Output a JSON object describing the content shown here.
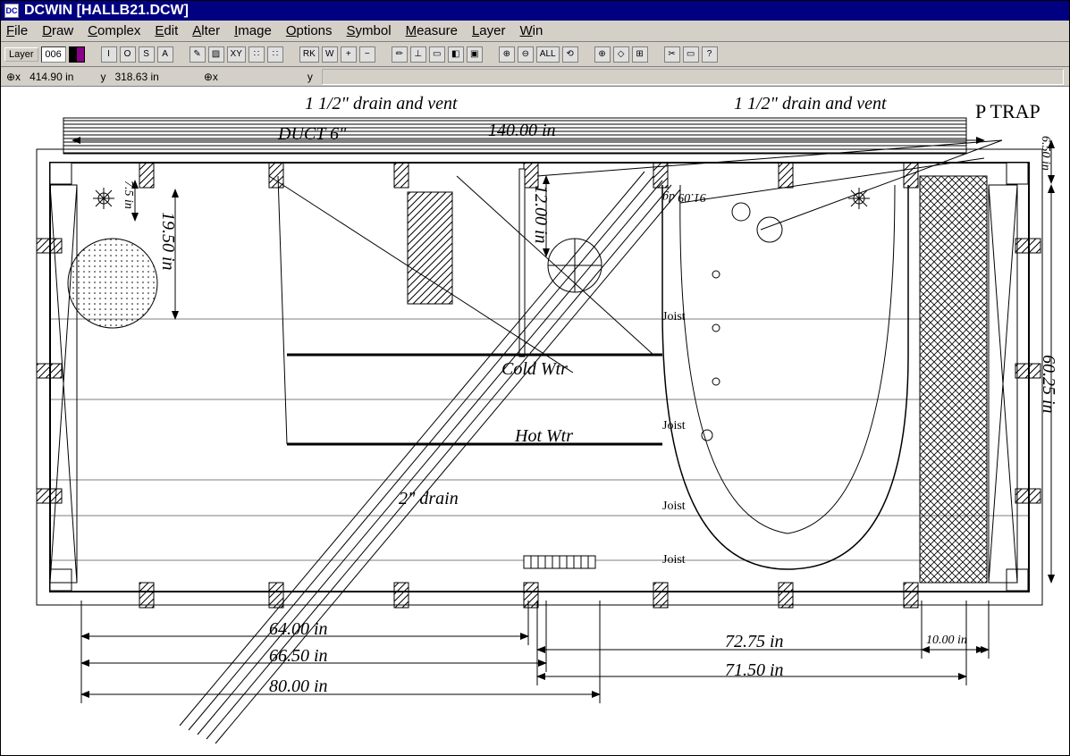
{
  "app": {
    "icon_label": "DC",
    "title": "DCWIN [HALLB21.DCW]"
  },
  "menu": {
    "items": [
      {
        "label": "File",
        "u": 0
      },
      {
        "label": "Draw",
        "u": 0
      },
      {
        "label": "Complex",
        "u": 0
      },
      {
        "label": "Edit",
        "u": 0
      },
      {
        "label": "Alter",
        "u": 0
      },
      {
        "label": "Image",
        "u": 0
      },
      {
        "label": "Options",
        "u": 0
      },
      {
        "label": "Symbol",
        "u": 0
      },
      {
        "label": "Measure",
        "u": 0
      },
      {
        "label": "Layer",
        "u": 0
      },
      {
        "label": "Win",
        "u": 0
      }
    ]
  },
  "toolbar": {
    "layer_button": "Layer",
    "layer_number": "006",
    "icons": [
      "I",
      "O",
      "S",
      "A",
      "✎",
      "▨",
      "XY",
      "∷",
      "∷",
      "RK",
      "W",
      "+",
      "−",
      "✏",
      "⊥",
      "▭",
      "◧",
      "▣",
      "⊕",
      "⊖",
      "ALL",
      "⟲",
      "⊕",
      "◇",
      "⊞",
      "✂",
      "▭",
      "?"
    ]
  },
  "status": {
    "abs_x_label": "⊕x",
    "abs_x": "414.90 in",
    "abs_y_label": "y",
    "abs_y": "318.63 in",
    "rel_x_label": "⊕x",
    "rel_y_label": "y"
  },
  "drawing": {
    "top_text1": "1 1/2\" drain and vent",
    "top_text2": "1 1/2\" drain and vent",
    "ptrap": "P TRAP",
    "duct": "DUCT 6\"",
    "width_dim": "140.00 in",
    "left_vdim": "19.50 in",
    "left_vdim2": "7.5 in",
    "ctr_vdim": "12.00 in",
    "right_vdim": "60.25 in",
    "top_right_vdim": "6.50 in",
    "angle_dim": "91.09 dg",
    "cold_wtr": "Cold Wtr",
    "hot_wtr": "Hot Wtr",
    "drain2": "2\" drain",
    "joist": "Joist",
    "bottom_dims": {
      "d1": "64.00 in",
      "d2": "66.50 in",
      "d3": "80.00 in",
      "d4": "72.75 in",
      "d5": "71.50 in",
      "d6": "10.00 in"
    }
  }
}
